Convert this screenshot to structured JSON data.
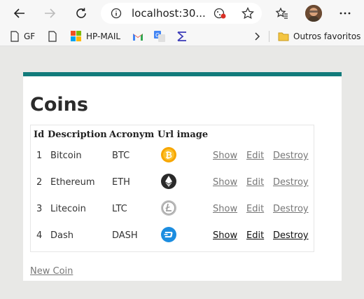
{
  "browser": {
    "url": "localhost:30...",
    "avatar": "user-avatar"
  },
  "bookmarks": {
    "items": [
      {
        "label": "GF",
        "icon": "file-icon"
      },
      {
        "label": "",
        "icon": "file-icon"
      },
      {
        "label": "HP-MAIL",
        "icon": "windows-icon"
      },
      {
        "label": "",
        "icon": "gmail-icon"
      },
      {
        "label": "",
        "icon": "translate-icon"
      },
      {
        "label": "",
        "icon": "sigma-icon"
      }
    ],
    "other_favorites": "Outros favoritos"
  },
  "page": {
    "title": "Coins",
    "headers": {
      "id": "Id",
      "description": "Description",
      "acronym": "Acronym",
      "url_image": "Url image"
    },
    "rows": [
      {
        "id": "1",
        "description": "Bitcoin",
        "acronym": "BTC",
        "icon": "bitcoin-icon",
        "color": "#f7a600",
        "show": "Show",
        "edit": "Edit",
        "destroy": "Destroy"
      },
      {
        "id": "2",
        "description": "Ethereum",
        "acronym": "ETH",
        "icon": "ethereum-icon",
        "color": "#2a2a2a",
        "show": "Show",
        "edit": "Edit",
        "destroy": "Destroy"
      },
      {
        "id": "3",
        "description": "Litecoin",
        "acronym": "LTC",
        "icon": "litecoin-icon",
        "color": "#bdbdbd",
        "show": "Show",
        "edit": "Edit",
        "destroy": "Destroy"
      },
      {
        "id": "4",
        "description": "Dash",
        "acronym": "DASH",
        "icon": "dash-icon",
        "color": "#1c8de0",
        "show": "Show",
        "edit": "Edit",
        "destroy": "Destroy"
      }
    ],
    "new_link": "New Coin"
  },
  "colors": {
    "accent": "#127b7b",
    "page_background": "#e8e8e6",
    "link": "#777777"
  }
}
